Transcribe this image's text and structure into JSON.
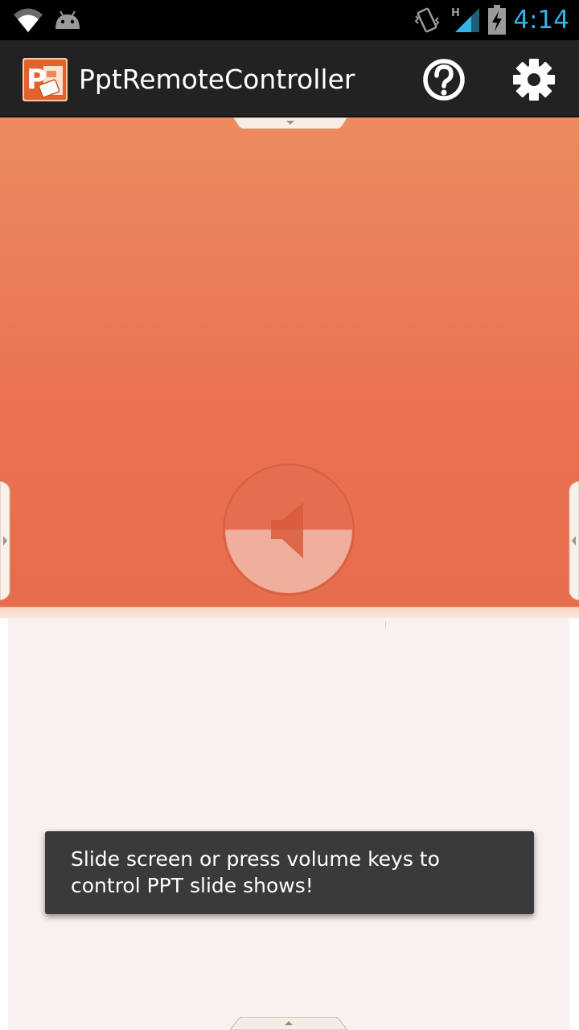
{
  "status_bar": {
    "time": "4:14",
    "network_type": "H",
    "icons": [
      "wifi-icon",
      "android-debug-icon",
      "vibrate-icon",
      "signal-icon",
      "battery-charging-icon"
    ],
    "clock_color": "#33b5e5"
  },
  "action_bar": {
    "app_icon": "powerpoint-icon",
    "title": "PptRemoteController",
    "help_icon": "help-icon",
    "settings_icon": "gear-icon"
  },
  "slide_pad": {
    "center_control": "volume-off-icon",
    "top_handle": "chevron-down-icon",
    "left_handle": "chevron-right-icon",
    "right_handle": "chevron-left-icon",
    "colors": {
      "gradient_top": "#ec8b5e",
      "gradient_bottom": "#e76d4c"
    }
  },
  "lower_panel": {
    "bottom_handle": "chevron-up-icon",
    "background": "#f9f1ef"
  },
  "toast": {
    "message": "Slide screen or press volume keys to control PPT slide shows!"
  }
}
